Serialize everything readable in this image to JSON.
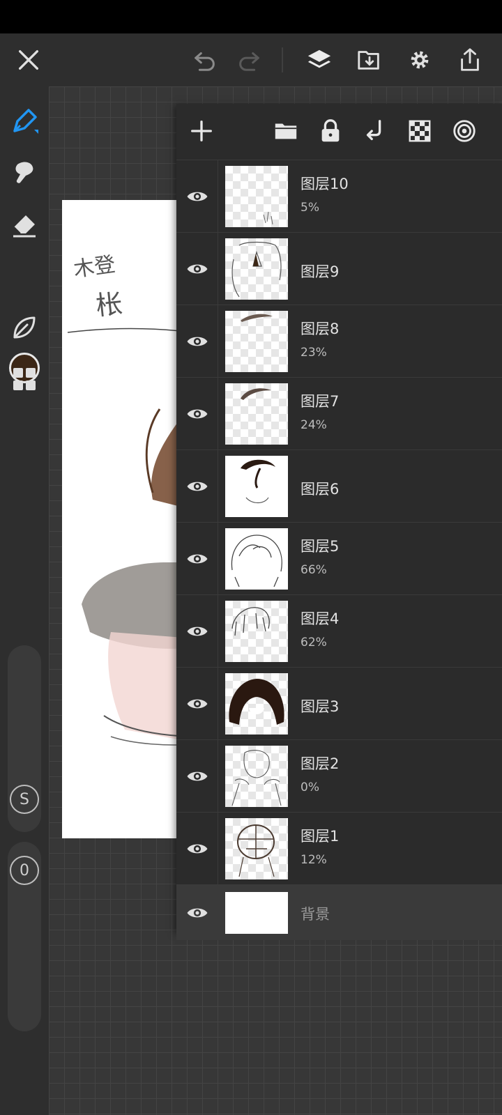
{
  "colors": {
    "accent": "#2196f3",
    "current_color": "#3c2716",
    "panel_bg": "#2b2b2b",
    "toolbar_bg": "#2e2e2e"
  },
  "top_toolbar": {
    "icons": [
      "close-icon",
      "undo-icon",
      "redo-icon",
      "layers-icon",
      "import-icon",
      "settings-icon",
      "share-icon"
    ]
  },
  "left_toolbar": {
    "tools": [
      "brush-icon",
      "smudge-icon",
      "eraser-icon",
      "color-swatch",
      "leaf-icon",
      "grid-icon"
    ],
    "size_slider_label": "S",
    "opacity_slider_label": "0"
  },
  "artboard_text": {
    "handwritten_line1": "木登",
    "handwritten_line2": "枨"
  },
  "layer_panel": {
    "toolbar_icons": [
      "add-icon",
      "folder-icon",
      "lock-icon",
      "merge-down-icon",
      "transparency-icon",
      "blend-mode-icon"
    ],
    "layers": [
      {
        "name": "图层10",
        "opacity": "5%"
      },
      {
        "name": "图层9",
        "opacity": ""
      },
      {
        "name": "图层8",
        "opacity": "23%"
      },
      {
        "name": "图层7",
        "opacity": "24%"
      },
      {
        "name": "图层6",
        "opacity": ""
      },
      {
        "name": "图层5",
        "opacity": "66%"
      },
      {
        "name": "图层4",
        "opacity": "62%"
      },
      {
        "name": "图层3",
        "opacity": ""
      },
      {
        "name": "图层2",
        "opacity": "0%"
      },
      {
        "name": "图层1",
        "opacity": "12%"
      }
    ],
    "background_layer": {
      "name": "背景"
    }
  }
}
